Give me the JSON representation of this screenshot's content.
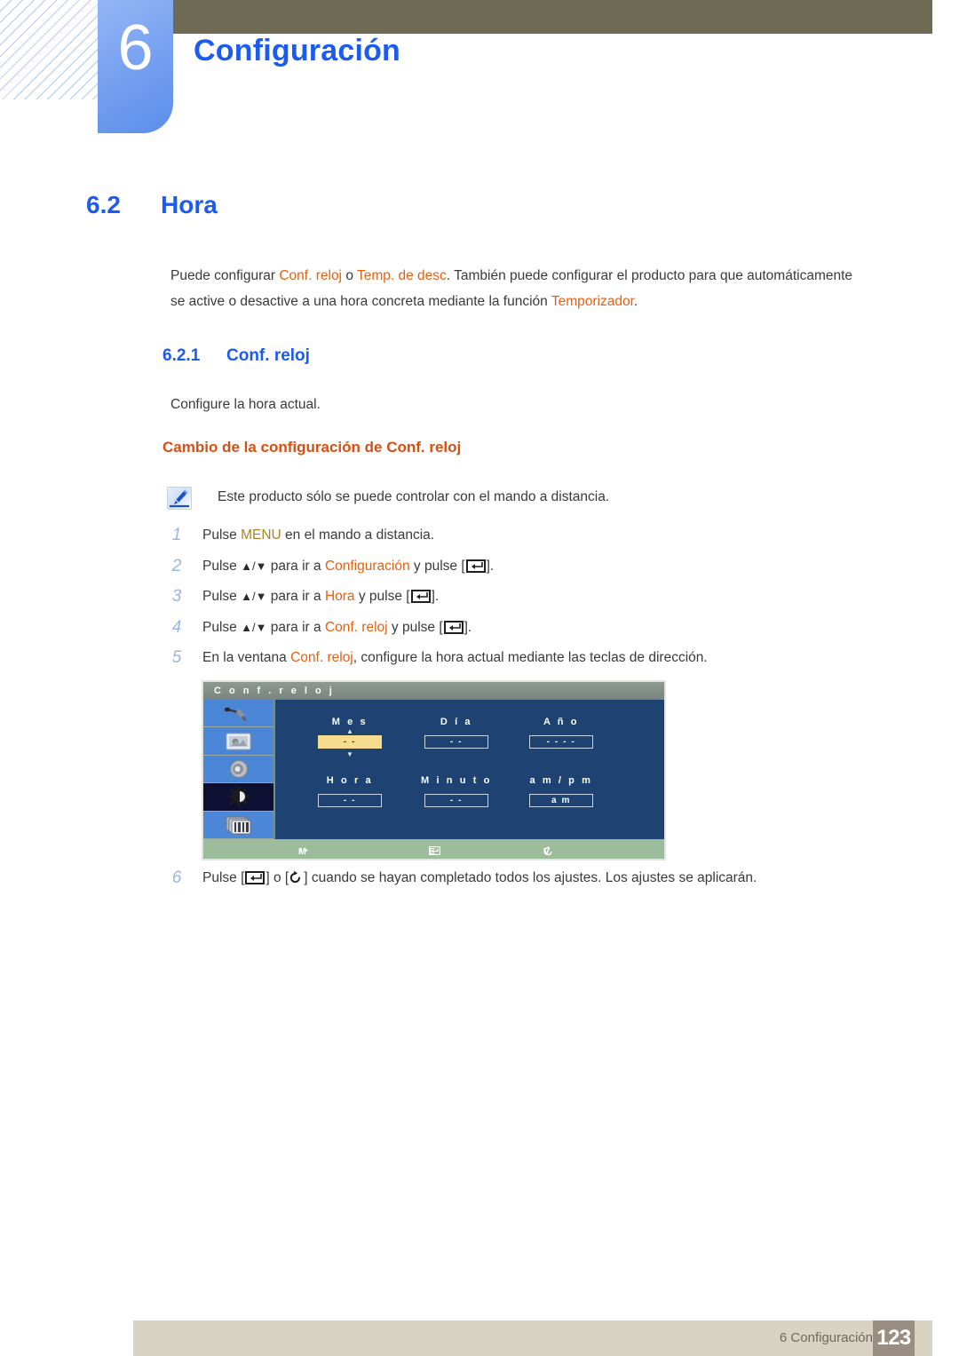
{
  "header": {
    "chapter_number": "6",
    "chapter_title": "Configuración"
  },
  "section": {
    "number": "6.2",
    "title": "Hora",
    "intro_prefix": "Puede configurar ",
    "intro_term1": "Conf. reloj",
    "intro_mid1": " o ",
    "intro_term2": "Temp. de desc",
    "intro_mid2": ". También puede configurar el producto para que automáticamente se active o desactive a una hora concreta mediante la función ",
    "intro_term3": "Temporizador",
    "intro_suffix": "."
  },
  "subsection": {
    "number": "6.2.1",
    "title": "Conf. reloj",
    "description": "Configure la hora actual.",
    "orange_heading": "Cambio de la configuración de Conf. reloj"
  },
  "note": {
    "icon": "note-pencil-icon",
    "text": "Este producto sólo se puede controlar con el mando a distancia."
  },
  "steps": [
    {
      "number": "1",
      "parts": [
        {
          "t": "Pulse ",
          "s": "plain"
        },
        {
          "t": "MENU",
          "s": "gold"
        },
        {
          "t": " en el mando a distancia.",
          "s": "plain"
        }
      ]
    },
    {
      "number": "2",
      "parts": [
        {
          "t": "Pulse ",
          "s": "plain"
        },
        {
          "t": "▲/▼",
          "s": "arrow"
        },
        {
          "t": " para ir a ",
          "s": "plain"
        },
        {
          "t": "Configuración",
          "s": "orange"
        },
        {
          "t": " y pulse [",
          "s": "plain"
        },
        {
          "t": "",
          "s": "enter-key"
        },
        {
          "t": "].",
          "s": "plain"
        }
      ]
    },
    {
      "number": "3",
      "parts": [
        {
          "t": "Pulse ",
          "s": "plain"
        },
        {
          "t": "▲/▼",
          "s": "arrow"
        },
        {
          "t": " para ir a ",
          "s": "plain"
        },
        {
          "t": "Hora",
          "s": "orange"
        },
        {
          "t": " y pulse [",
          "s": "plain"
        },
        {
          "t": "",
          "s": "enter-key"
        },
        {
          "t": "].",
          "s": "plain"
        }
      ]
    },
    {
      "number": "4",
      "parts": [
        {
          "t": "Pulse ",
          "s": "plain"
        },
        {
          "t": "▲/▼",
          "s": "arrow"
        },
        {
          "t": " para ir a ",
          "s": "plain"
        },
        {
          "t": "Conf. reloj",
          "s": "orange"
        },
        {
          "t": " y pulse [",
          "s": "plain"
        },
        {
          "t": "",
          "s": "enter-key"
        },
        {
          "t": "].",
          "s": "plain"
        }
      ]
    },
    {
      "number": "5",
      "parts": [
        {
          "t": "En la ventana ",
          "s": "plain"
        },
        {
          "t": "Conf. reloj",
          "s": "orange"
        },
        {
          "t": ", configure la hora actual mediante las teclas de dirección.",
          "s": "plain"
        }
      ]
    },
    {
      "number": "6",
      "parts": [
        {
          "t": "Pulse [",
          "s": "plain"
        },
        {
          "t": "",
          "s": "enter-key"
        },
        {
          "t": "] o [",
          "s": "plain"
        },
        {
          "t": "",
          "s": "return-key"
        },
        {
          "t": "] cuando se hayan completado todos los ajustes. Los ajustes se aplicarán.",
          "s": "plain"
        }
      ]
    }
  ],
  "osd": {
    "title": "C o n f .  r e l o j",
    "sidebar_icons": [
      {
        "name": "input-source-icon",
        "selected": false
      },
      {
        "name": "picture-icon",
        "selected": false
      },
      {
        "name": "sound-speaker-icon",
        "selected": false
      },
      {
        "name": "setup-gear-icon",
        "selected": true
      },
      {
        "name": "multi-display-icon",
        "selected": false
      }
    ],
    "fields": [
      {
        "label": "M e s",
        "value": "- -",
        "selected": true
      },
      {
        "label": "D í a",
        "value": "- -",
        "selected": false
      },
      {
        "label": "A ñ o",
        "value": "- - - -",
        "selected": false
      },
      {
        "label": "H o r a",
        "value": "- -",
        "selected": false
      },
      {
        "label": "M i n u t o",
        "value": "- -",
        "selected": false
      },
      {
        "label": "a m / p m",
        "value": "a m",
        "selected": false
      }
    ],
    "footer": {
      "move": "M o v e r",
      "enter": "E n t r a r",
      "back": "V o l v e r"
    }
  },
  "footer": {
    "chapter_label": "6 Configuración",
    "page_number": "123"
  },
  "colors": {
    "brand_blue": "#1c5bef",
    "accent_orange": "#e8600f",
    "heading_orange": "#d94e12",
    "gold": "#a8822b",
    "olive_bar": "#6e6a53",
    "footer_bar": "#d8d3c2",
    "page_badge": "#9a8d81",
    "osd_bg": "#1e4272",
    "osd_highlight": "#f5dc8e",
    "osd_footer": "#9cbc9c"
  }
}
